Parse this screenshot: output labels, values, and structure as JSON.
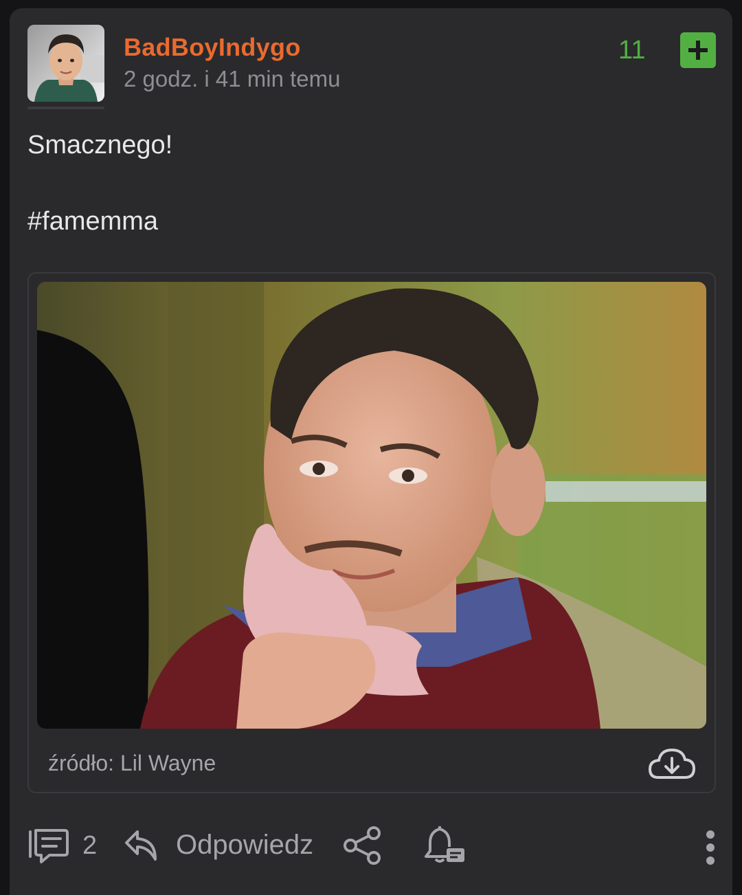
{
  "post": {
    "author": "BadBoyIndygo",
    "timestamp": "2 godz. i 41 min temu",
    "votes": "11",
    "vote_button_icon": "plus-icon",
    "text_lines": [
      "Smacznego!",
      "#famemma"
    ],
    "media": {
      "source_label": "źródło: Lil Wayne",
      "download_icon": "cloud-download-icon"
    },
    "actions": {
      "comments_count": "2",
      "reply_label": "Odpowiedz",
      "share_icon": "share-icon",
      "notify_icon": "bell-comment-icon",
      "more_icon": "more-vertical-icon"
    }
  },
  "colors": {
    "background": "#141416",
    "card": "#2a2a2d",
    "author": "#ea6a2e",
    "vote_green": "#52b043",
    "text": "#e8e8ea",
    "muted": "#a5a5aa"
  }
}
